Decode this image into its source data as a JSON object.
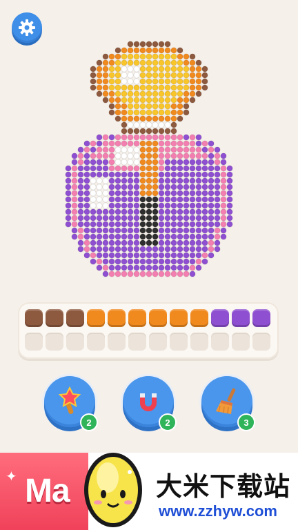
{
  "settings": {
    "icon": "gear-icon"
  },
  "artwork": {
    "subject": "potion-bottle",
    "palette": {
      "brown": "#8e5a3f",
      "orange": "#f0891e",
      "yellow": "#f8c52a",
      "white": "#ffffff",
      "pink": "#f37fb0",
      "purple": "#8e4fd1",
      "black": "#2e2e2e"
    }
  },
  "tray": {
    "filled_slots": [
      "brown",
      "brown",
      "brown",
      "orange",
      "orange",
      "orange",
      "orange",
      "orange",
      "orange",
      "purple",
      "purple",
      "purple"
    ],
    "empty_slots": 12
  },
  "boosters": [
    {
      "name": "magic-wand",
      "count": "2"
    },
    {
      "name": "magnet",
      "count": "2"
    },
    {
      "name": "broom",
      "count": "3"
    }
  ],
  "ad": {
    "left_text": "Ma",
    "title": "大米下载站",
    "url": "www.zzhyw.com"
  }
}
